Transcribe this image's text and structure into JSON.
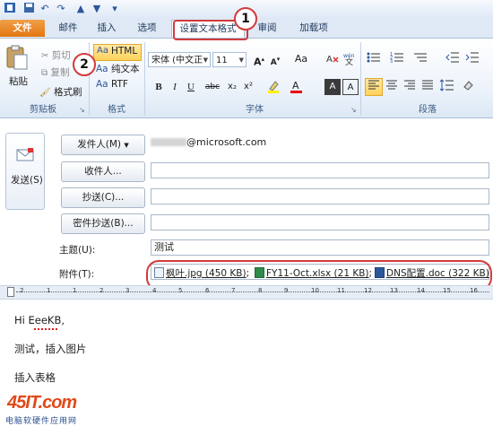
{
  "quick_access": [
    "save-icon",
    "undo-icon",
    "redo-icon",
    "up-arrow-icon",
    "down-arrow-icon",
    "customize-icon"
  ],
  "tabs": [
    {
      "label": "文件"
    },
    {
      "label": "邮件"
    },
    {
      "label": "插入"
    },
    {
      "label": "选项"
    },
    {
      "label": "设置文本格式"
    },
    {
      "label": "审阅"
    },
    {
      "label": "加载项"
    }
  ],
  "ribbon": {
    "clipboard": {
      "paste": "粘贴",
      "cut": "剪切",
      "copy": "复制",
      "format_painter": "格式刷",
      "group_label": "剪贴板"
    },
    "format": {
      "html_prefix": "Aa",
      "html": "HTML",
      "plain_prefix": "Aa",
      "plain": "纯文本",
      "rtf_prefix": "Aa",
      "rtf": "RTF",
      "group_label": "格式"
    },
    "font": {
      "font_name": "宋体 (中文正",
      "font_size": "11",
      "grow": "A",
      "shrink": "A",
      "aa": "Aa",
      "bold": "B",
      "italic": "I",
      "underline": "U",
      "strike": "abc",
      "subscript": "x₂",
      "superscript": "x²",
      "group_label": "字体"
    },
    "paragraph": {
      "group_label": "段落"
    }
  },
  "markers": {
    "one": "1",
    "two": "2"
  },
  "compose": {
    "send": "发送(S)",
    "from_button": "发件人(M)",
    "from_value": "@microsoft.com",
    "to_button": "收件人...",
    "cc_button": "抄送(C)...",
    "bcc_button": "密件抄送(B)...",
    "subject_label": "主题(U):",
    "subject_value": "测试",
    "attach_label": "附件(T):",
    "attachments": [
      {
        "name": "枫叶.jpg (450 KB)",
        "icon": "image-file-icon"
      },
      {
        "name": "FY11-Oct.xlsx (21 KB)",
        "icon": "excel-file-icon"
      },
      {
        "name": "DNS配置.doc (322 KB)",
        "icon": "word-file-icon"
      }
    ]
  },
  "ruler": [
    "2",
    "1",
    "1",
    "2",
    "3",
    "4",
    "5",
    "6",
    "7",
    "8",
    "9",
    "10",
    "11",
    "12",
    "13",
    "14",
    "15",
    "16"
  ],
  "body": {
    "line1": "Hi EeeKB,",
    "line2": "测试，插入图片",
    "line3": "插入表格"
  },
  "watermark": {
    "logo": "45IT.com",
    "subtitle": "电脑软硬件应用网"
  },
  "colors": {
    "file_tab": "#e3760f",
    "callout": "#d13b3b",
    "ribbon": "#dde8f5"
  }
}
